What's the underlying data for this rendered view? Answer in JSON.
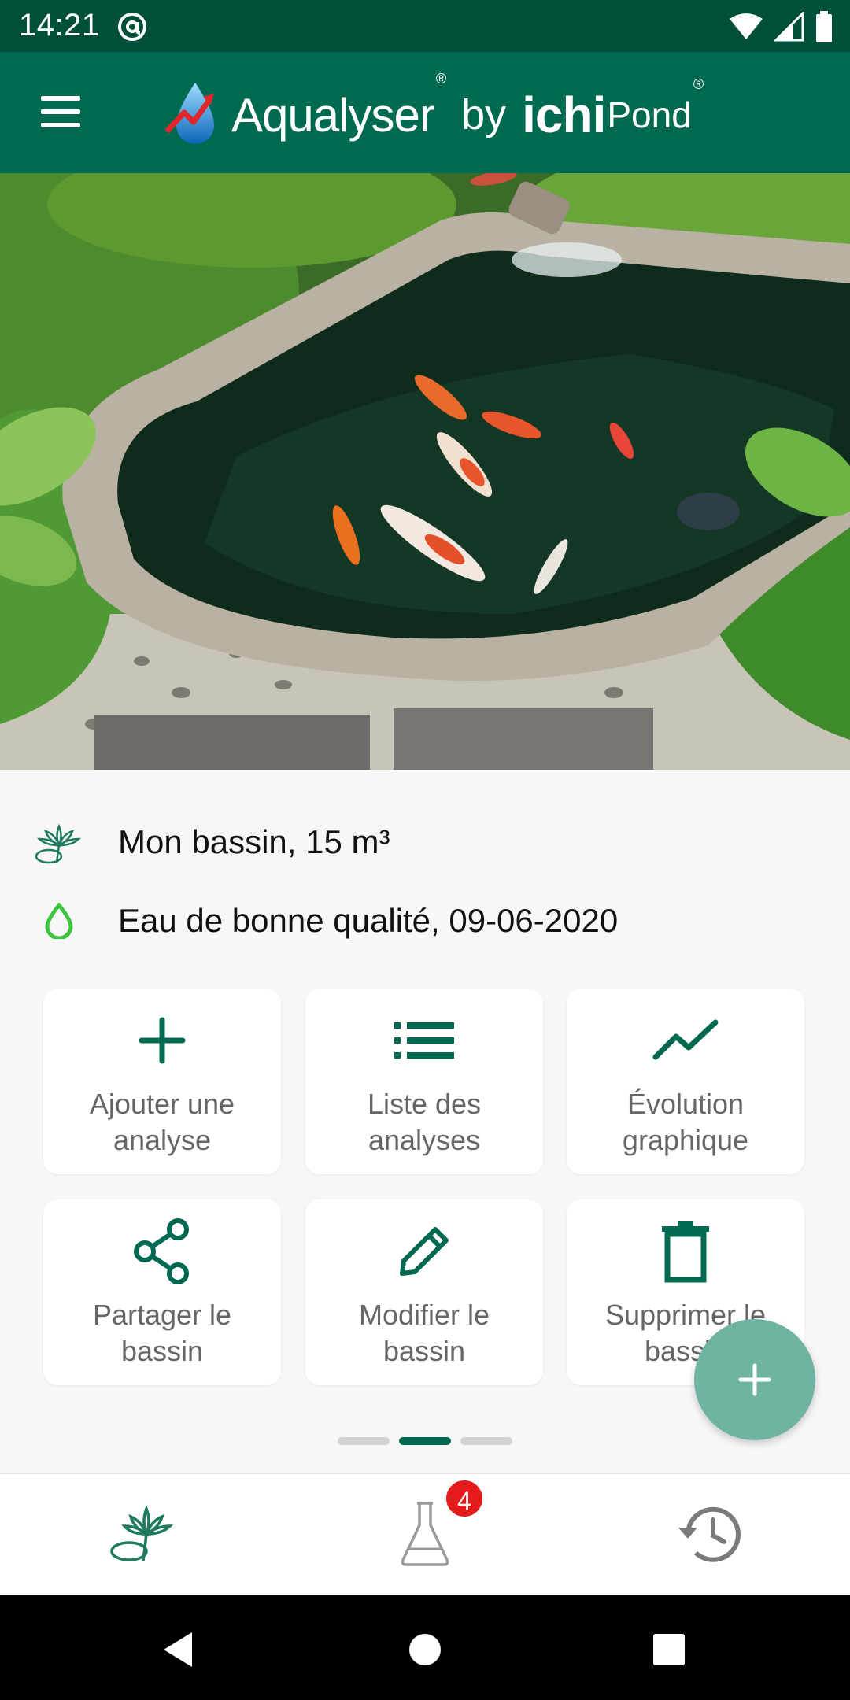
{
  "status_bar": {
    "time": "14:21"
  },
  "app_bar": {
    "brand_name": "Aqualyser",
    "brand_sup": "®",
    "by": "by",
    "partner_ichi": "ichi",
    "partner_pond": "Pond",
    "partner_sup": "®"
  },
  "pond": {
    "name_volume": "Mon bassin, 15 m³",
    "water_quality": "Eau de bonne qualité, 09-06-2020"
  },
  "actions": [
    {
      "label": "Ajouter une\nanalyse",
      "icon": "plus-icon"
    },
    {
      "label": "Liste des\nanalyses",
      "icon": "list-icon"
    },
    {
      "label": "Évolution\ngraphique",
      "icon": "trend-chart-icon"
    },
    {
      "label": "Partager le\nbassin",
      "icon": "share-icon"
    },
    {
      "label": "Modifier le\nbassin",
      "icon": "pencil-icon"
    },
    {
      "label": "Supprimer le\nbassin",
      "icon": "trash-icon"
    }
  ],
  "pager": {
    "pages": 3,
    "active": 2
  },
  "bottom_nav": {
    "items": [
      "pond-icon",
      "flask-icon",
      "history-icon"
    ],
    "badge_count": "4"
  },
  "colors": {
    "status_bar": "#004f3a",
    "app_bar": "#006a50",
    "accent": "#006a50",
    "fab": "#6fb4a3",
    "badge": "#e51b1b",
    "quality_drop": "#3cc43c"
  }
}
